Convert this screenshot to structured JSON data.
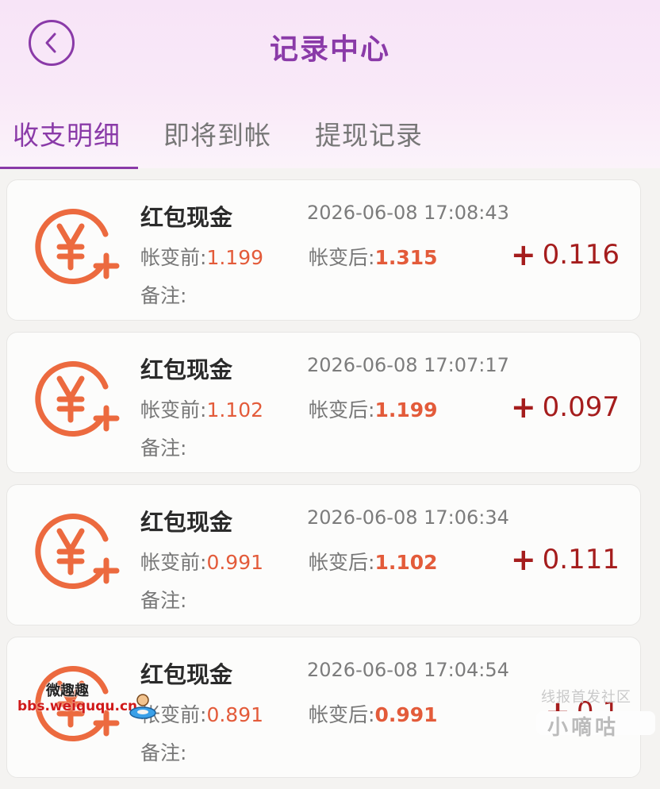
{
  "header": {
    "title": "记录中心",
    "back_icon": "chevron-left-icon"
  },
  "tabs": [
    {
      "label": "收支明细",
      "active": true
    },
    {
      "label": "即将到帐",
      "active": false
    },
    {
      "label": "提现记录",
      "active": false
    }
  ],
  "colors": {
    "accent": "#8a3aa8",
    "icon": "#ec6a3f",
    "value": "#e35b3a",
    "amount": "#a51d1d"
  },
  "records": [
    {
      "title": "红包现金",
      "time": "2026-06-08 17:08:43",
      "before_label": "帐变前:",
      "before": "1.199",
      "after_label": "帐变后:",
      "after": "1.315",
      "note_label": "备注:",
      "amount": "0.116",
      "icon": "yuan-plus-icon"
    },
    {
      "title": "红包现金",
      "time": "2026-06-08 17:07:17",
      "before_label": "帐变前:",
      "before": "1.102",
      "after_label": "帐变后:",
      "after": "1.199",
      "note_label": "备注:",
      "amount": "0.097",
      "icon": "yuan-plus-icon"
    },
    {
      "title": "红包现金",
      "time": "2026-06-08 17:06:34",
      "before_label": "帐变前:",
      "before": "0.991",
      "after_label": "帐变后:",
      "after": "1.102",
      "note_label": "备注:",
      "amount": "0.111",
      "icon": "yuan-plus-icon"
    },
    {
      "title": "红包现金",
      "time": "2026-06-08 17:04:54",
      "before_label": "帐变前:",
      "before": "0.891",
      "after_label": "帐变后:",
      "after": "0.991",
      "note_label": "备注:",
      "amount": "0.1",
      "icon": "yuan-plus-icon"
    }
  ],
  "watermarks": {
    "left_top": "微趣趣",
    "left_bottom": "bbs.weiququ.cn",
    "right_top": "线报首发社区",
    "right_badge": "小嘀咕"
  }
}
